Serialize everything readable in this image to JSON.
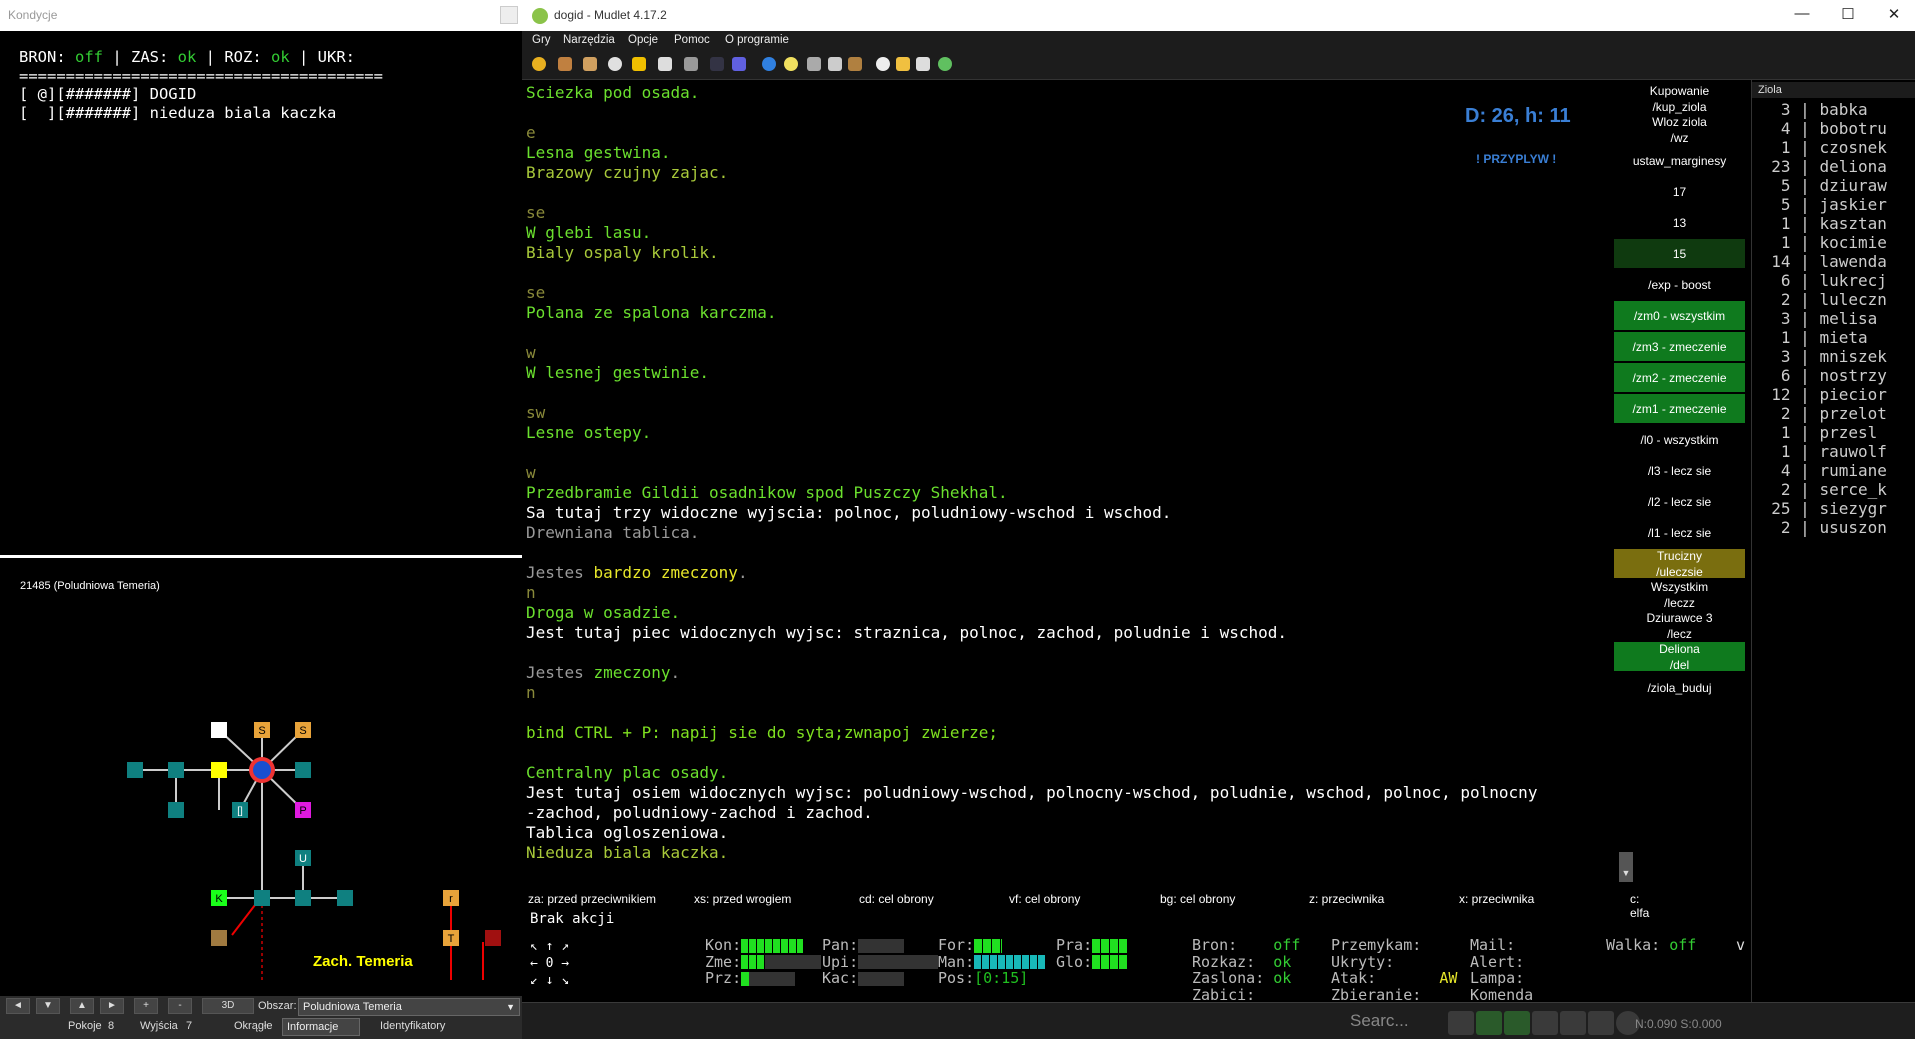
{
  "kondycje": {
    "title": "Kondycje",
    "line1_prefix": "BRON: ",
    "line1_bron": "off",
    "line1_mid": " | ZAS: ",
    "line1_zas": "ok",
    "line1_mid2": " | ROZ: ",
    "line1_roz": "ok",
    "line1_end": " | UKR:",
    "rule": "=======================================",
    "row1": "[ @][#######] DOGID",
    "row2": "[  ][#######] nieduza biala kaczka"
  },
  "map": {
    "room_label": "21485 (Poludniowa Temeria)",
    "area_name": "Zach. Temeria",
    "room_letters": [
      "S",
      "S",
      "P",
      "K",
      "U",
      "[]",
      "r",
      "T"
    ],
    "btn_3d": "3D",
    "obszar_label": "Obszar:",
    "obszar_value": "Poludniowa Temeria",
    "pokoje_label": "Pokoje",
    "pokoje_value": "8",
    "wyjscia_label": "Wyjścia",
    "wyjscia_value": "7",
    "okragle_label": "Okrągłe",
    "informacje_value": "Informacje",
    "identyfikatory_label": "Identyfikatory",
    "nav": {
      "left": "◄",
      "down": "▼",
      "up": "▲",
      "right": "►",
      "plus": "+",
      "minus": "-"
    }
  },
  "window": {
    "title": "dogid - Mudlet 4.17.2",
    "controls": {
      "minimize": "—",
      "maximize": "☐",
      "close": "✕"
    }
  },
  "menus": [
    "Gry",
    "Narzędzia",
    "Opcje",
    "Pomoc",
    "O programie"
  ],
  "console_lines": [
    {
      "t": "Sciezka pod osada.",
      "c": "room"
    },
    {
      "t": "",
      "c": "white"
    },
    {
      "t": "e",
      "c": "dir"
    },
    {
      "t": "Lesna gestwina.",
      "c": "room"
    },
    {
      "t": "Brazowy czujny zajac.",
      "c": "mob"
    },
    {
      "t": "",
      "c": "white"
    },
    {
      "t": "se",
      "c": "dir"
    },
    {
      "t": "W glebi lasu.",
      "c": "room"
    },
    {
      "t": "Bialy ospaly krolik.",
      "c": "mob"
    },
    {
      "t": "",
      "c": "white"
    },
    {
      "t": "se",
      "c": "dir"
    },
    {
      "t": "Polana ze spalona karczma.",
      "c": "room"
    },
    {
      "t": "",
      "c": "white"
    },
    {
      "t": "w",
      "c": "dir"
    },
    {
      "t": "W lesnej gestwinie.",
      "c": "room"
    },
    {
      "t": "",
      "c": "white"
    },
    {
      "t": "sw",
      "c": "dir"
    },
    {
      "t": "Lesne ostepy.",
      "c": "room"
    },
    {
      "t": "",
      "c": "white"
    },
    {
      "t": "w",
      "c": "dir"
    },
    {
      "t": "Przedbramie Gildii osadnikow spod Puszczy Shekhal.",
      "c": "room"
    },
    {
      "t": "Sa tutaj trzy widoczne wyjscia: polnoc, poludniowy-wschod i wschod.",
      "c": "white"
    },
    {
      "t": "Drewniana tablica.",
      "c": "gray"
    },
    {
      "t": "",
      "c": "white"
    },
    {
      "t": "Jestes |bardzo zmeczony|.",
      "c": "gray",
      "hl": "yellow"
    },
    {
      "t": "n",
      "c": "dir"
    },
    {
      "t": "Droga w osadzie.",
      "c": "room"
    },
    {
      "t": "Jest tutaj piec widocznych wyjsc: straznica, polnoc, zachod, poludnie i wschod.",
      "c": "white"
    },
    {
      "t": "",
      "c": "white"
    },
    {
      "t": "Jestes |zmeczony|.",
      "c": "gray",
      "hl": "room"
    },
    {
      "t": "n",
      "c": "dir"
    },
    {
      "t": "",
      "c": "white"
    },
    {
      "t": "bind CTRL + P: napij sie do syta;zwnapoj zwierze;",
      "c": "bright"
    },
    {
      "t": "",
      "c": "white"
    },
    {
      "t": "Centralny plac osady.",
      "c": "room"
    },
    {
      "t": "Jest tutaj osiem widocznych wyjsc: poludniowy-wschod, polnocny-wschod, poludnie, wschod, polnoc, polnocny",
      "c": "white"
    },
    {
      "t": "-zachod, poludniowy-zachod i zachod.",
      "c": "white"
    },
    {
      "t": "Tablica ogloszeniowa.",
      "c": "white"
    },
    {
      "t": "Nieduza biala kaczka.",
      "c": "mob"
    }
  ],
  "overlay": {
    "dh": "D: 26, h: 11",
    "przyplyw": "! PRZYPLYW !"
  },
  "buttons": [
    {
      "label": "Kupowanie\n/kup_ziola",
      "bg": "#000000"
    },
    {
      "label": "Wloz ziola\n/wz",
      "bg": "#000000"
    },
    {
      "label": "ustaw_marginesy",
      "bg": "#000000"
    },
    {
      "label": "17",
      "bg": "#000000"
    },
    {
      "label": "13",
      "bg": "#000000"
    },
    {
      "label": "15",
      "bg": "#0f3a0f"
    },
    {
      "label": "/exp - boost",
      "bg": "#000000"
    },
    {
      "label": "/zm0 - wszystkim",
      "bg": "#0f7a1e"
    },
    {
      "label": "/zm3 - zmeczenie",
      "bg": "#0f7a1e"
    },
    {
      "label": "/zm2 - zmeczenie",
      "bg": "#0f7a1e"
    },
    {
      "label": "/zm1 - zmeczenie",
      "bg": "#0f7a1e"
    },
    {
      "label": "/l0 - wszystkim",
      "bg": "#000000"
    },
    {
      "label": "/l3 - lecz sie",
      "bg": "#000000"
    },
    {
      "label": "/l2 - lecz sie",
      "bg": "#000000"
    },
    {
      "label": "/l1 - lecz sie",
      "bg": "#000000"
    },
    {
      "label": "Trucizny\n/uleczsie",
      "bg": "#7a6e0f"
    },
    {
      "label": "Wszystkim\n/leczz",
      "bg": "#000000"
    },
    {
      "label": "Dziurawce 3\n/lecz",
      "bg": "#000000"
    },
    {
      "label": "Deliona\n/del",
      "bg": "#0f7a1e"
    },
    {
      "label": "/ziola_buduj",
      "bg": "#000000"
    }
  ],
  "ziola": {
    "title": "Ziola",
    "items": [
      {
        "n": "3",
        "name": "babka"
      },
      {
        "n": "4",
        "name": "bobotru"
      },
      {
        "n": "1",
        "name": "czosnek"
      },
      {
        "n": "23",
        "name": "deliona"
      },
      {
        "n": "5",
        "name": "dziuraw"
      },
      {
        "n": "5",
        "name": "jaskier"
      },
      {
        "n": "1",
        "name": "kasztan"
      },
      {
        "n": "1",
        "name": "kocimie"
      },
      {
        "n": "14",
        "name": "lawenda"
      },
      {
        "n": "6",
        "name": "lukrecj"
      },
      {
        "n": "2",
        "name": "luleczn"
      },
      {
        "n": "3",
        "name": "melisa"
      },
      {
        "n": "1",
        "name": "mieta"
      },
      {
        "n": "3",
        "name": "mniszek"
      },
      {
        "n": "6",
        "name": "nostrzy"
      },
      {
        "n": "12",
        "name": "piecior"
      },
      {
        "n": "2",
        "name": "przelot"
      },
      {
        "n": "1",
        "name": "przesl"
      },
      {
        "n": "1",
        "name": "rauwolf"
      },
      {
        "n": "4",
        "name": "rumiane"
      },
      {
        "n": "2",
        "name": "serce_k"
      },
      {
        "n": "25",
        "name": "siezygr"
      },
      {
        "n": "2",
        "name": "ususzon"
      }
    ]
  },
  "tags": [
    "za: przed przeciwnikiem",
    "xs: przed wrogiem",
    "cd: cel obrony",
    "vf: cel obrony",
    "bg: cel obrony",
    "z: przeciwnika",
    "x: przeciwnika",
    "c: elfa"
  ],
  "brak_akcji": "Brak akcji",
  "compass": {
    "row1": "↖ ↑ ↗",
    "row2": "← 0 →",
    "row3": "↙ ↓ ↘"
  },
  "stats": {
    "kon": "Kon:",
    "zme": "Zme:",
    "prz": "Prz:",
    "pan": "Pan:",
    "upi": "Upi:",
    "kac": "Kac:",
    "for": "For:",
    "man": "Man:",
    "pos": "Pos:",
    "pos_val": "[0:15]",
    "pra": "Pra:",
    "glo": "Glo:",
    "bron": "Bron:",
    "bron_val": "off",
    "rozkaz": "Rozkaz:",
    "rozkaz_val": "ok",
    "zaslona": "Zaslona:",
    "zaslona_val": "ok",
    "zabici": "Zabici:",
    "przemykam": "Przemykam:",
    "ukryty": "Ukryty:",
    "atak": "Atak:",
    "atak_val": "AW",
    "zbieranie": "Zbieranie:",
    "mail": "Mail:",
    "alert": "Alert:",
    "lampa": "Lampa:",
    "komenda": "Komenda",
    "walka": "Walka:",
    "walka_val": "off",
    "v": "v"
  },
  "cmd": {
    "search_placeholder": "Searc...",
    "netinfo": "N:0.090 S:0.000"
  },
  "colors": {
    "room": "#6be02e",
    "dir": "#8a8a3a",
    "mob": "#a8c93a",
    "accent_blue": "#3a7fd5",
    "bar_green": "#20e020",
    "bar_cyan": "#18b8b8"
  }
}
